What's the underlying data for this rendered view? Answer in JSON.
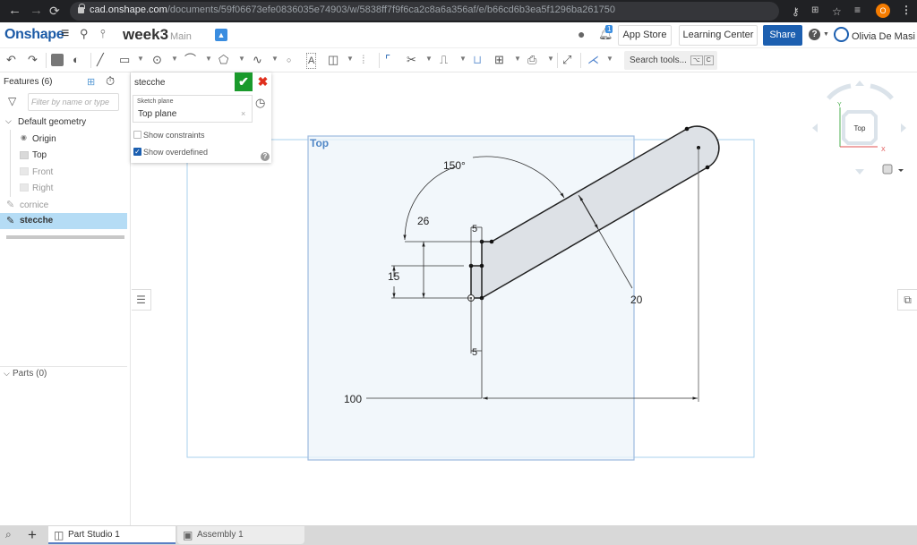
{
  "browser": {
    "url_host": "cad.onshape.com",
    "url_path": "/documents/59f06673efe0836035e74903/w/5838ff7f9f6ca2c8a6a356af/e/b66cd6b3ea5f1296ba261750",
    "profile_initial": "O"
  },
  "app": {
    "logo": "Onshape",
    "document_name": "week3",
    "branch": "Main",
    "notification_count": "1",
    "app_store_label": "App Store",
    "learning_center_label": "Learning Center",
    "share_label": "Share",
    "help_label": "?",
    "user_name": "Olivia De Masi"
  },
  "toolbar": {
    "search_placeholder": "Search tools...",
    "shortcut_keys": [
      "⌥",
      "C"
    ]
  },
  "feature_panel": {
    "title": "Features (6)",
    "filter_placeholder": "Filter by name or type",
    "default_geometry_label": "Default geometry",
    "items": [
      {
        "label": "Origin",
        "type": "origin"
      },
      {
        "label": "Top",
        "type": "plane",
        "visible": true
      },
      {
        "label": "Front",
        "type": "plane",
        "visible": false
      },
      {
        "label": "Right",
        "type": "plane",
        "visible": false
      },
      {
        "label": "cornice",
        "type": "sketch",
        "dim": true
      },
      {
        "label": "stecche",
        "type": "sketch",
        "selected": true
      }
    ],
    "parts_label": "Parts (0)"
  },
  "sketch_dialog": {
    "name": "stecche",
    "sketch_plane_label": "Sketch plane",
    "sketch_plane_value": "Top plane",
    "show_constraints_label": "Show constraints",
    "show_constraints_checked": false,
    "show_overdefined_label": "Show overdefined",
    "show_overdefined_checked": true
  },
  "viewport": {
    "plane_label": "Top",
    "view_cube_label": "Top",
    "axis_x": "X",
    "axis_y": "Y",
    "dimensions": {
      "angle": "150°",
      "height_total": "26",
      "height_step": "15",
      "width_top": "5",
      "width_bottom": "5",
      "slot_width": "20",
      "horizontal_length": "100"
    }
  },
  "bottom_tabs": [
    {
      "label": "Part Studio 1",
      "active": true
    },
    {
      "label": "Assembly 1",
      "active": false
    }
  ]
}
